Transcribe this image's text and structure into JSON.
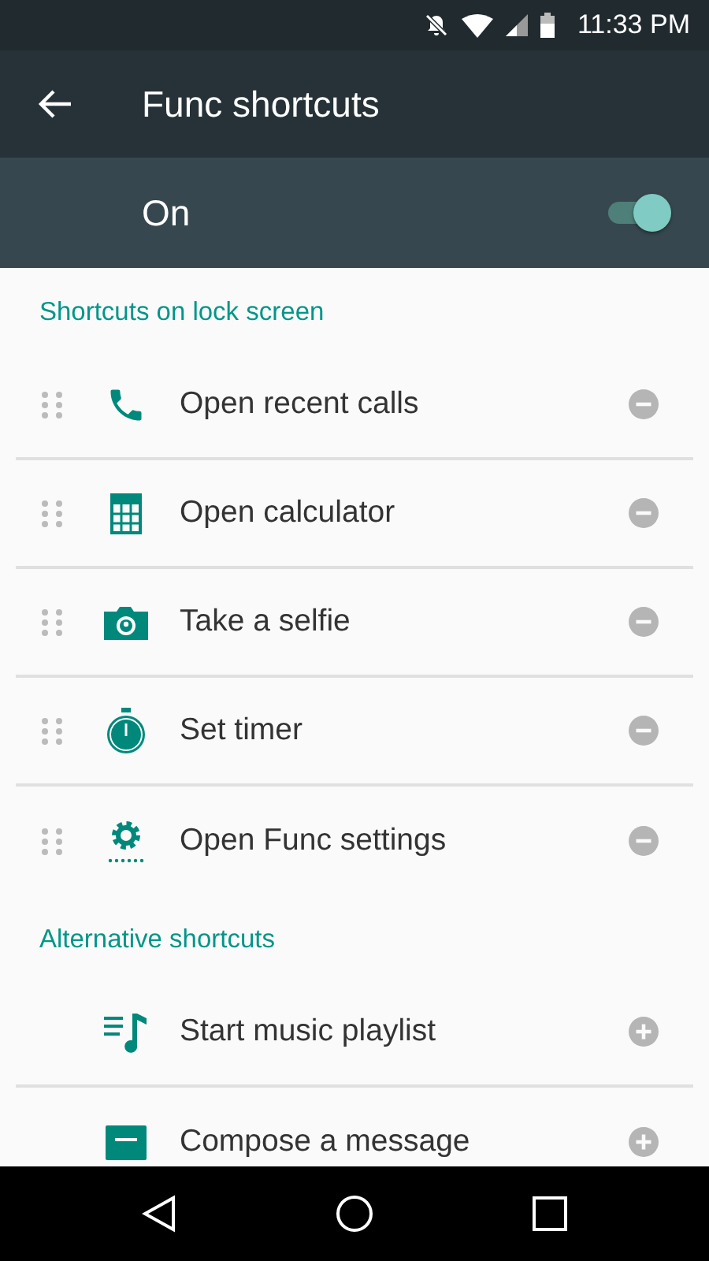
{
  "status_bar": {
    "time": "11:33 PM"
  },
  "toolbar": {
    "title": "Func shortcuts"
  },
  "master_switch": {
    "label": "On",
    "on": true
  },
  "sections": [
    {
      "header": "Shortcuts on lock screen",
      "items": [
        {
          "label": "Open recent calls",
          "kind": "remove"
        },
        {
          "label": "Open calculator",
          "kind": "remove"
        },
        {
          "label": "Take a selfie",
          "kind": "remove"
        },
        {
          "label": "Set timer",
          "kind": "remove"
        },
        {
          "label": "Open Func settings",
          "kind": "remove"
        }
      ]
    },
    {
      "header": "Alternative shortcuts",
      "items": [
        {
          "label": "Start music playlist",
          "kind": "add"
        },
        {
          "label": "Compose a message",
          "kind": "add"
        }
      ]
    }
  ]
}
